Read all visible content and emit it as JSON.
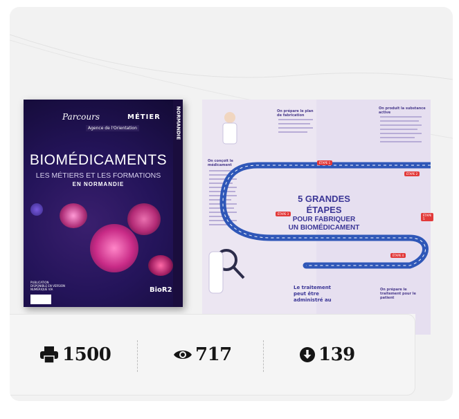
{
  "cover": {
    "brand": "Parcours",
    "metier": "MÉTIER",
    "agence": "Agence de l'Orientation",
    "side_tag": "NORMANDIE",
    "title": "BIOMÉDICAMENTS",
    "subtitle": "LES MÉTIERS ET LES FORMATIONS",
    "subtitle_region": "EN NORMANDIE",
    "publication": "PUBLICATION DISPONIBLE EN VERSION NUMÉRIQUE VIA",
    "partner": "BioR2"
  },
  "brochure": {
    "heading_plan": "On prépare le plan de fabrication",
    "heading_substance": "On produit la substance active",
    "heading_conceit": "On conçoit le médicament",
    "big_title_line1": "5 GRANDES",
    "big_title_line2": "ÉTAPES",
    "big_title_line3": "POUR FABRIQUER",
    "big_title_line4": "UN BIOMÉDICAMENT",
    "etape_labels": [
      "ÉTAPE 1",
      "ÉTAPE 2",
      "ÉTAPE 3",
      "ÉTAPE 4",
      "ÉTAPE 5"
    ],
    "traitement": "Le traitement peut être administré au",
    "prepare_patient": "On prépare le traitement pour le patient"
  },
  "stats": {
    "prints": "1500",
    "views": "717",
    "downloads": "139"
  },
  "icons": {
    "prints": "printer-icon",
    "views": "eye-icon",
    "downloads": "download-circle-icon"
  }
}
